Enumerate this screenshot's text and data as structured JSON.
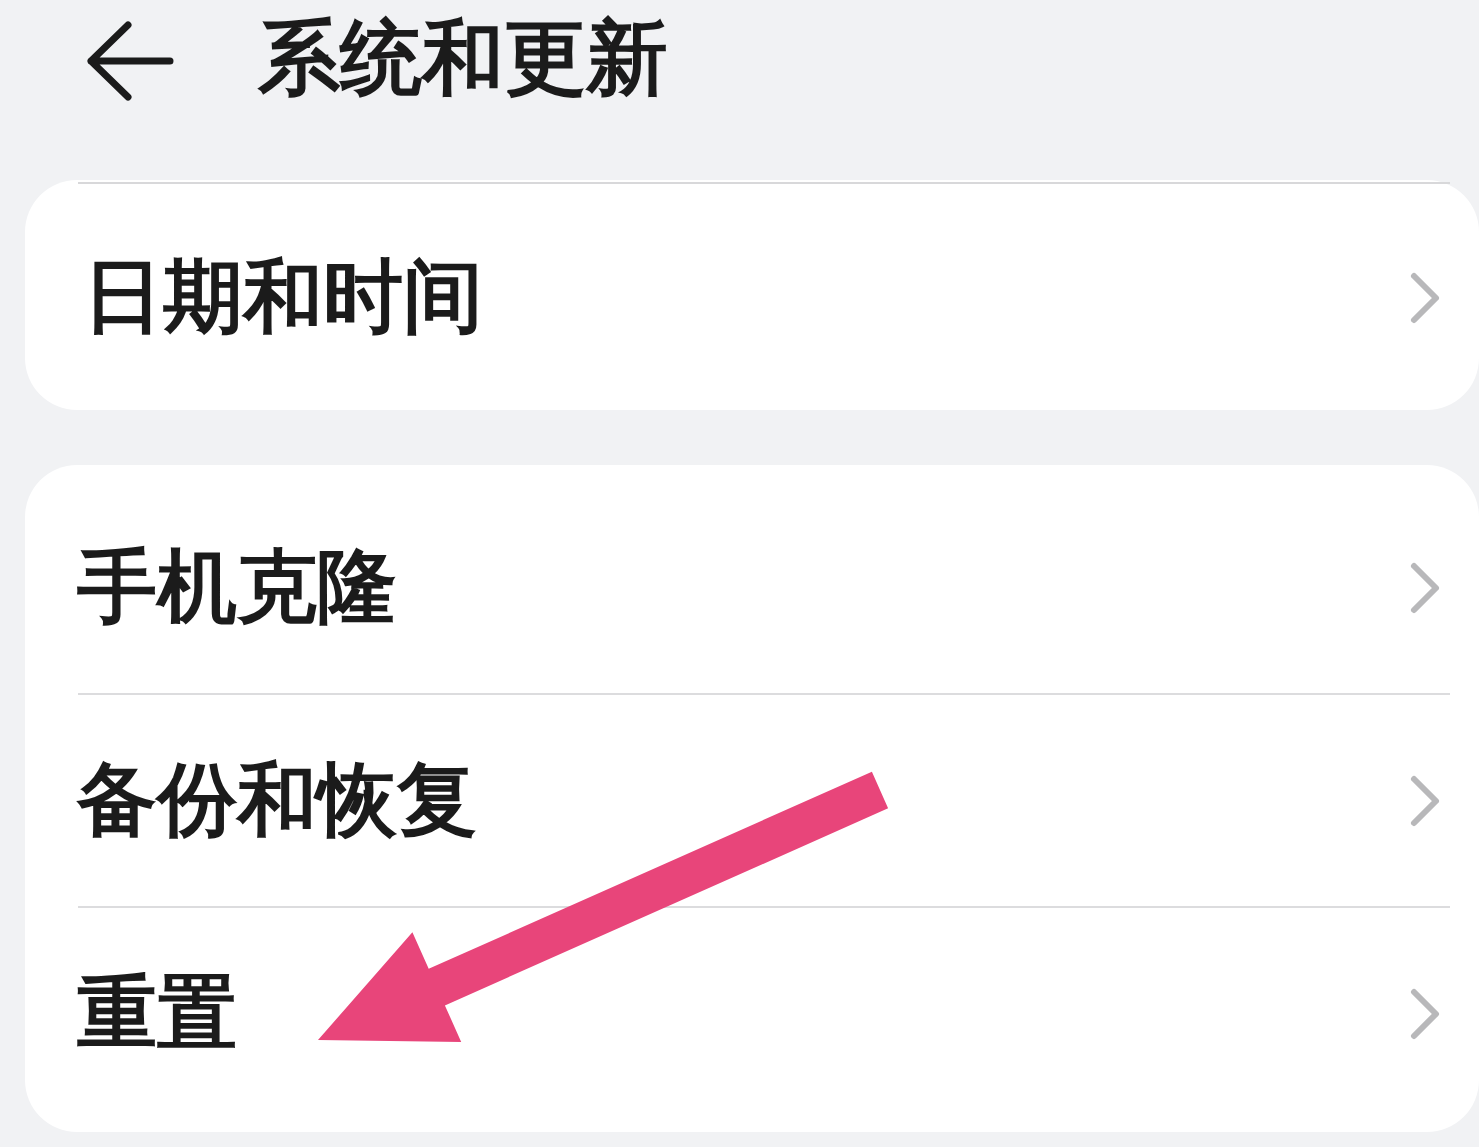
{
  "header": {
    "title": "系统和更新"
  },
  "groups": [
    {
      "items": [
        {
          "label": "日期和时间"
        }
      ]
    },
    {
      "items": [
        {
          "label": "手机克隆"
        },
        {
          "label": "备份和恢复"
        },
        {
          "label": "重置"
        }
      ]
    }
  ],
  "annotation": {
    "kind": "arrow"
  }
}
